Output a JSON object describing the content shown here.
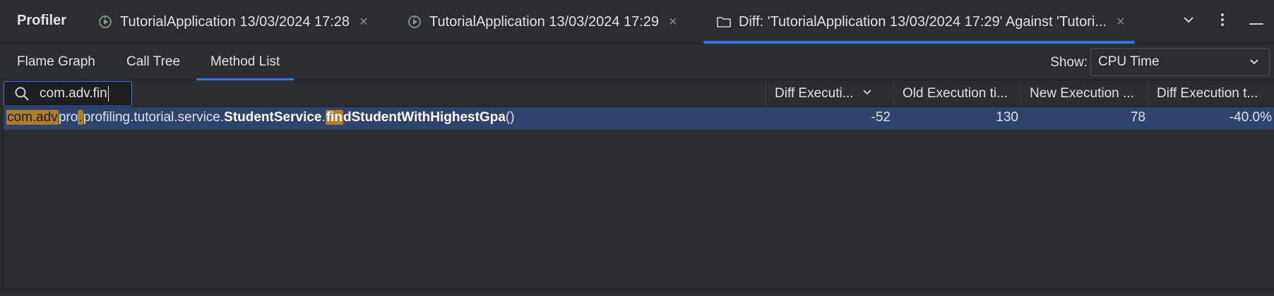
{
  "header": {
    "title": "Profiler",
    "tabs": [
      {
        "label": "TutorialApplication 13/03/2024 17:28",
        "icon": "profiler-run-icon"
      },
      {
        "label": "TutorialApplication 13/03/2024 17:29",
        "icon": "profiler-run-icon"
      },
      {
        "label": "Diff: 'TutorialApplication 13/03/2024 17:29' Against 'Tutori...",
        "icon": "folder-icon",
        "active": true
      }
    ],
    "close_glyph": "×",
    "actions": [
      "chevron-down-icon",
      "more-vertical-icon",
      "minimize-icon"
    ]
  },
  "views": {
    "tabs": [
      "Flame Graph",
      "Call Tree",
      "Method List"
    ],
    "active": "Method List",
    "show_label": "Show:",
    "show_value": "CPU Time"
  },
  "table": {
    "search_value": "com.adv.fin",
    "columns": [
      "Diff Executi...",
      "Old Execution ti...",
      "New Execution ...",
      "Diff Execution t..."
    ],
    "rows": [
      {
        "method_parts": {
          "p1": "com.adv",
          "p2": "pro",
          "p3": ".",
          "p4": "profiling.tutorial.service.",
          "p5": "StudentService",
          "p6": ".",
          "p7": "fin",
          "p8": "dStudentWithHighestGpa",
          "p9": "()"
        },
        "diff": "-52",
        "old": "130",
        "new": "78",
        "diff_pct": "-40.0%"
      }
    ]
  },
  "colors": {
    "background": "#2b2d30",
    "accent": "#3574f0",
    "selection": "#2e436e",
    "match_highlight": "#b07d2b"
  }
}
